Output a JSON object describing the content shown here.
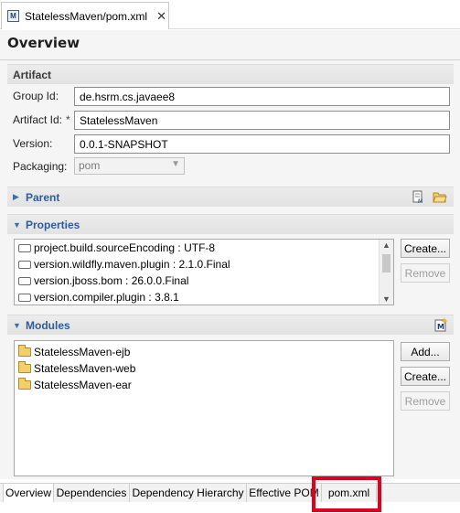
{
  "editor_tab": {
    "title": "StatelessMaven/pom.xml",
    "icon": "maven-pom-icon",
    "close": "✕"
  },
  "page_title": "Overview",
  "artifact": {
    "section_title": "Artifact",
    "group_id_label": "Group Id:",
    "group_id_value": "de.hsrm.cs.javaee8",
    "artifact_id_label": "Artifact Id:",
    "required_marker": "*",
    "artifact_id_value": "StatelessMaven",
    "version_label": "Version:",
    "version_value": "0.0.1-SNAPSHOT",
    "packaging_label": "Packaging:",
    "packaging_value": "pom"
  },
  "parent": {
    "section_title": "Parent"
  },
  "properties": {
    "section_title": "Properties",
    "items": [
      "project.build.sourceEncoding : UTF-8",
      "version.wildfly.maven.plugin : 2.1.0.Final",
      "version.jboss.bom : 26.0.0.Final",
      "version.compiler.plugin : 3.8.1"
    ],
    "create_label": "Create...",
    "remove_label": "Remove"
  },
  "modules": {
    "section_title": "Modules",
    "items": [
      "StatelessMaven-ejb",
      "StatelessMaven-web",
      "StatelessMaven-ear"
    ],
    "add_label": "Add...",
    "create_label": "Create...",
    "remove_label": "Remove"
  },
  "page_tabs": [
    "Overview",
    "Dependencies",
    "Dependency Hierarchy",
    "Effective POM",
    "pom.xml"
  ],
  "colors": {
    "highlight": "#e0001b",
    "section_blue": "#2e5c9a"
  }
}
